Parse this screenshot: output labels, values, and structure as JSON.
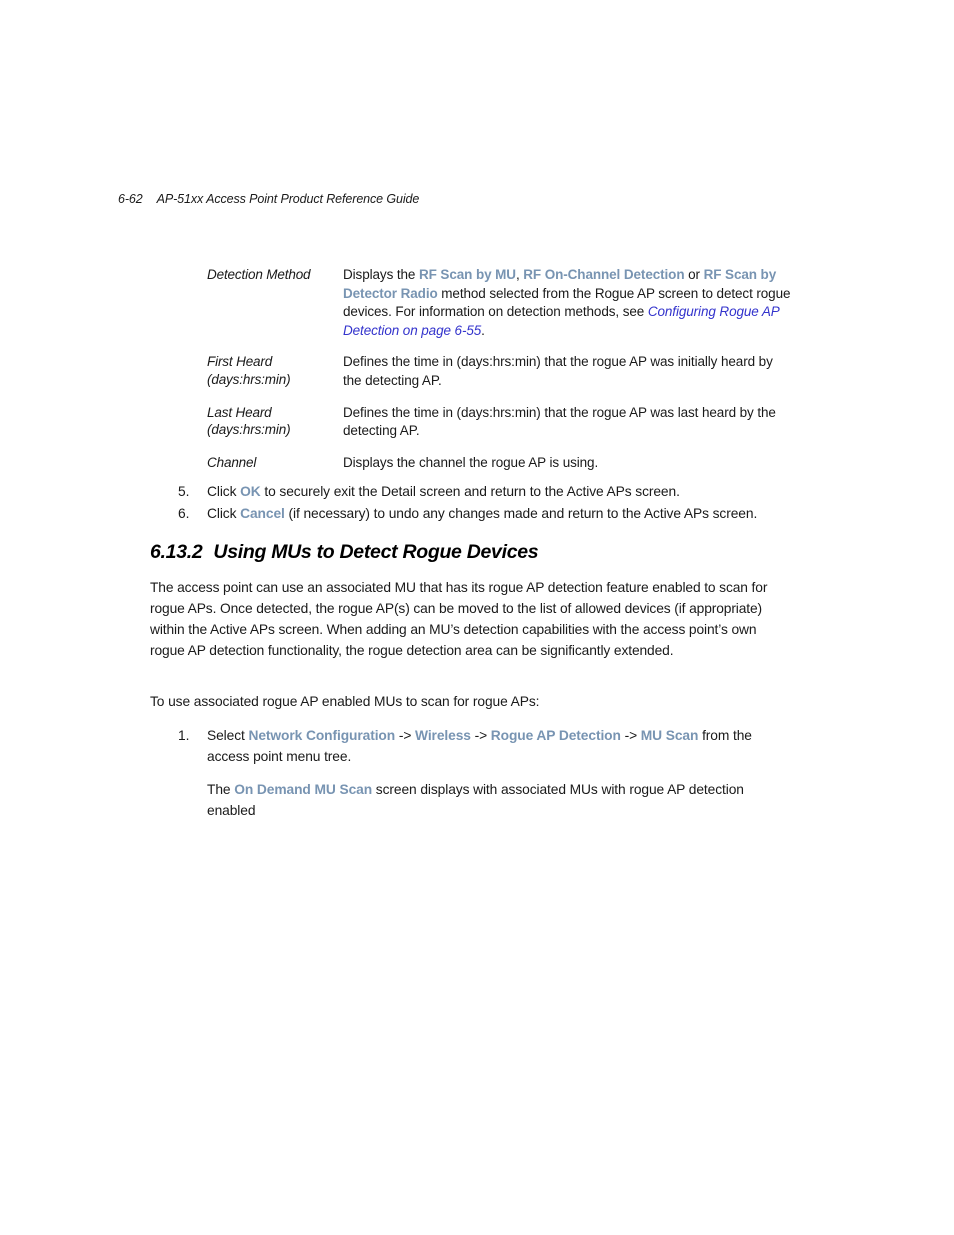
{
  "header": {
    "folio": "6-62",
    "title": "AP-51xx Access Point Product Reference Guide"
  },
  "colors": {
    "ui_term": "#7894b2",
    "cross_reference": "#3333cc",
    "body_text": "#1a1a1a",
    "page_background": "#ffffff"
  },
  "definition_table": {
    "rows": [
      {
        "term": "Detection Method",
        "term_sub": "",
        "description_runs": [
          {
            "text": "Displays the ",
            "style": "plain"
          },
          {
            "text": "RF Scan by MU",
            "style": "ui"
          },
          {
            "text": ", ",
            "style": "plain"
          },
          {
            "text": "RF On-Channel Detection",
            "style": "ui"
          },
          {
            "text": " or ",
            "style": "plain"
          },
          {
            "text": "RF Scan by Detector Radio",
            "style": "ui"
          },
          {
            "text": " method selected from the Rogue AP screen to detect rogue devices. For information on detection methods, see ",
            "style": "plain"
          },
          {
            "text": "Configuring Rogue AP Detection on page 6-55",
            "style": "xref"
          },
          {
            "text": ".",
            "style": "plain"
          }
        ]
      },
      {
        "term": "First Heard",
        "term_sub": "(days:hrs:min)",
        "description_runs": [
          {
            "text": "Defines the time in (days:hrs:min) that the rogue AP was initially heard by the detecting AP.",
            "style": "plain"
          }
        ]
      },
      {
        "term": "Last Heard",
        "term_sub": "(days:hrs:min)",
        "description_runs": [
          {
            "text": "Defines the time in (days:hrs:min) that the rogue AP was last heard by the detecting AP.",
            "style": "plain"
          }
        ]
      },
      {
        "term": "Channel",
        "term_sub": "",
        "description_runs": [
          {
            "text": "Displays the channel the rogue AP is using.",
            "style": "plain"
          }
        ]
      }
    ]
  },
  "numbered_steps_upper": [
    {
      "marker": "5.",
      "runs": [
        {
          "text": "Click ",
          "style": "plain"
        },
        {
          "text": "OK",
          "style": "ui"
        },
        {
          "text": " to securely exit the Detail screen and return to the Active APs screen.",
          "style": "plain"
        }
      ]
    },
    {
      "marker": "6.",
      "runs": [
        {
          "text": "Click ",
          "style": "plain"
        },
        {
          "text": "Cancel",
          "style": "ui"
        },
        {
          "text": " (if necessary) to undo any changes made and return to the Active APs screen.",
          "style": "plain"
        }
      ]
    }
  ],
  "section": {
    "number": "6.13.2",
    "title": "Using MUs to Detect Rogue Devices",
    "paragraphs": [
      "The access point can use an associated MU that has its rogue AP detection feature enabled to scan for rogue APs. Once detected, the rogue AP(s) can be moved to the list of allowed devices (if appropriate) within the Active APs screen. When adding an MU’s detection capabilities with the access point’s own rogue AP detection functionality, the rogue detection area can be significantly extended."
    ],
    "lead_in": "To use associated rogue AP enabled MUs to scan for rogue APs:",
    "steps": [
      {
        "marker": "1.",
        "runs": [
          {
            "text": "Select ",
            "style": "plain"
          },
          {
            "text": "Network Configuration",
            "style": "ui"
          },
          {
            "text": " -> ",
            "style": "plain"
          },
          {
            "text": "Wireless",
            "style": "ui"
          },
          {
            "text": " -> ",
            "style": "plain"
          },
          {
            "text": "Rogue AP Detection",
            "style": "ui"
          },
          {
            "text": " -> ",
            "style": "plain"
          },
          {
            "text": "MU Scan",
            "style": "ui"
          },
          {
            "text": " from the access point menu tree.",
            "style": "plain"
          }
        ],
        "follow_runs": [
          {
            "text": "The ",
            "style": "plain"
          },
          {
            "text": "On Demand MU Scan",
            "style": "ui"
          },
          {
            "text": " screen displays with associated MUs with rogue AP detection enabled",
            "style": "plain"
          }
        ]
      }
    ]
  }
}
